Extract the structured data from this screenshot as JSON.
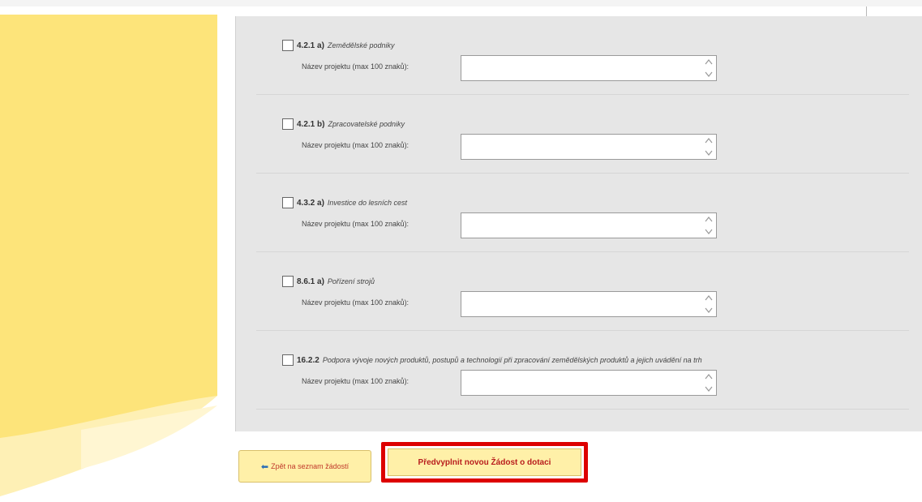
{
  "projects": [
    {
      "code": "4.2.1 a)",
      "description": "Zemědělské podniky",
      "field_label": "Název projektu (max 100 znaků):",
      "value": ""
    },
    {
      "code": "4.2.1 b)",
      "description": "Zpracovatelské podniky",
      "field_label": "Název projektu (max 100 znaků):",
      "value": ""
    },
    {
      "code": "4.3.2 a)",
      "description": "Investice do lesních cest",
      "field_label": "Název projektu (max 100 znaků):",
      "value": ""
    },
    {
      "code": "8.6.1 a)",
      "description": "Pořízení strojů",
      "field_label": "Název projektu (max 100 znaků):",
      "value": ""
    },
    {
      "code": "16.2.2",
      "description": "Podpora vývoje nových produktů, postupů a technologií při zpracování zemědělských produktů a jejich uvádění na trh",
      "field_label": "Název projektu (max 100 znaků):",
      "value": ""
    }
  ],
  "actions": {
    "back_label": "Zpět na seznam žádostí",
    "prefill_label": "Předvyplnit novou Žádost o dotaci"
  },
  "colors": {
    "panel_bg": "#e6e6e6",
    "side_yellow": "#fde47a",
    "button_bg": "#fff0a8",
    "button_text": "#b81d1d",
    "highlight_border": "#dd0000",
    "back_arrow": "#2a6db5"
  },
  "icons": {
    "back": "arrow-left-icon",
    "spinner": "up-down-arrows-icon"
  }
}
